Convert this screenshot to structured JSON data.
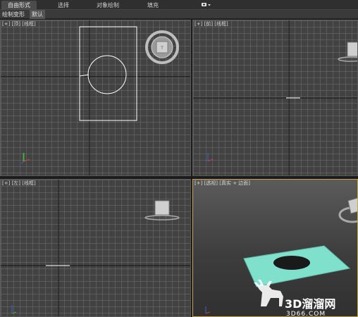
{
  "ribbon": {
    "tabs": [
      {
        "label": "自由形式",
        "active": true
      },
      {
        "label": "选择",
        "active": false
      },
      {
        "label": "对象绘制",
        "active": false
      },
      {
        "label": "填充",
        "active": false
      }
    ],
    "extra_icon": "ribbon-options-icon"
  },
  "subribbon": {
    "left_label": "绘制变形",
    "right_label": "默认"
  },
  "viewports": {
    "top": {
      "plus": "[+]",
      "view": "[顶]",
      "shading": "[线框]"
    },
    "front": {
      "plus": "[+]",
      "view": "[前]",
      "shading": "[线框]"
    },
    "left": {
      "plus": "[+]",
      "view": "[左]",
      "shading": "[线框]"
    },
    "perspective": {
      "plus": "[+]",
      "view": "[透视]",
      "shading": "[真实 + 边面]"
    }
  },
  "watermark": {
    "brand": "3D溜溜网",
    "url": "3D66.COM"
  },
  "colors": {
    "active_border": "#c9a84a",
    "object_color": "#7fe0cc",
    "axis_x": "#c04040",
    "axis_y": "#40b040",
    "axis_z": "#4060d0"
  }
}
